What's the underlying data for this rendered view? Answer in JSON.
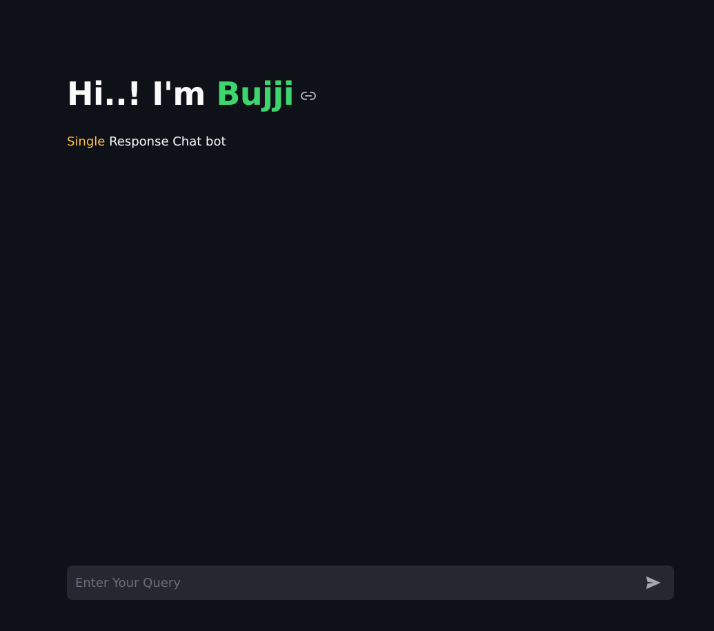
{
  "header": {
    "title_prefix": "Hi..! I'm ",
    "title_name": "Bujji",
    "anchor_icon": "link-icon"
  },
  "subtitle": {
    "highlight": "Single",
    "rest": " Response Chat bot"
  },
  "chat": {
    "placeholder": "Enter Your Query",
    "value": "",
    "send_icon": "send-icon"
  },
  "colors": {
    "background": "#0e1117",
    "accent_green": "#3dd56d",
    "accent_orange": "#ffbd45",
    "input_background": "#262730",
    "text": "#fafafa"
  }
}
